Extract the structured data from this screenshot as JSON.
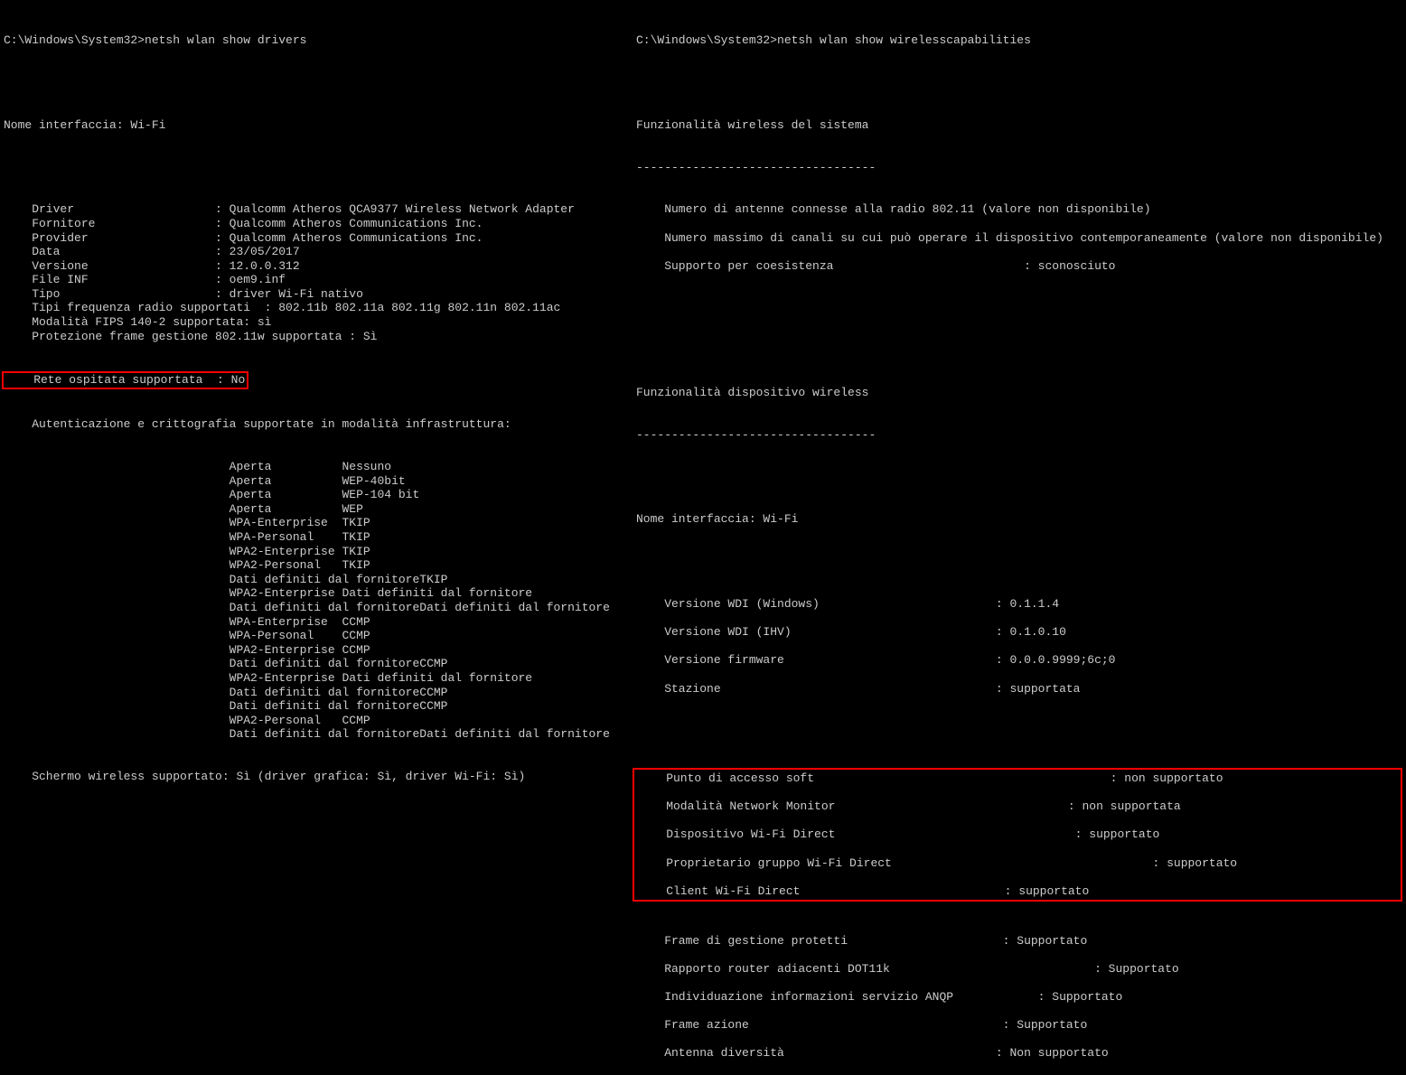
{
  "left": {
    "prompt": "C:\\Windows\\System32>netsh wlan show drivers",
    "iface": "Nome interfaccia: Wi-Fi",
    "rows": [
      "    Driver                    : Qualcomm Atheros QCA9377 Wireless Network Adapter",
      "    Fornitore                 : Qualcomm Atheros Communications Inc.",
      "    Provider                  : Qualcomm Atheros Communications Inc.",
      "    Data                      : 23/05/2017",
      "    Versione                  : 12.0.0.312",
      "    File INF                  : oem9.inf",
      "    Tipo                      : driver Wi-Fi nativo",
      "    Tipi frequenza radio supportati  : 802.11b 802.11a 802.11g 802.11n 802.11ac",
      "    Modalità FIPS 140-2 supportata: sì",
      "    Protezione frame gestione 802.11w supportata : Sì"
    ],
    "hosted": "    Rete ospitata supportata  : No",
    "auth_title": "    Autenticazione e crittografia supportate in modalità infrastruttura:",
    "auth_rows": [
      "                                Aperta          Nessuno",
      "                                Aperta          WEP-40bit",
      "                                Aperta          WEP-104 bit",
      "                                Aperta          WEP",
      "                                WPA-Enterprise  TKIP",
      "                                WPA-Personal    TKIP",
      "                                WPA2-Enterprise TKIP",
      "                                WPA2-Personal   TKIP",
      "                                Dati definiti dal fornitoreTKIP",
      "                                WPA2-Enterprise Dati definiti dal fornitore",
      "                                Dati definiti dal fornitoreDati definiti dal fornitore",
      "                                WPA-Enterprise  CCMP",
      "                                WPA-Personal    CCMP",
      "                                WPA2-Enterprise CCMP",
      "                                Dati definiti dal fornitoreCCMP",
      "                                WPA2-Enterprise Dati definiti dal fornitore",
      "                                Dati definiti dal fornitoreCCMP",
      "                                Dati definiti dal fornitoreCCMP",
      "                                WPA2-Personal   CCMP",
      "                                Dati definiti dal fornitoreDati definiti dal fornitore"
    ],
    "wireless_display": "    Schermo wireless supportato: Sì (driver grafica: Sì, driver Wi-Fi: Sì)"
  },
  "right": {
    "prompt": "C:\\Windows\\System32>netsh wlan show wirelesscapabilities",
    "sys_title": "Funzionalità wireless del sistema",
    "dashes1": "----------------------------------",
    "sys_rows": [
      "    Numero di antenne connesse alla radio 802.11 (valore non disponibile)",
      "",
      "    Numero massimo di canali su cui può operare il dispositivo contemporaneamente (valore non disponibile)",
      "",
      "    Supporto per coesistenza                           : sconosciuto"
    ],
    "dev_title": "Funzionalità dispositivo wireless",
    "dashes2": "----------------------------------",
    "iface": "Nome interfaccia: Wi-Fi",
    "dev_rows1": [
      "    Versione WDI (Windows)                         : 0.1.1.4",
      "",
      "    Versione WDI (IHV)                             : 0.1.0.10",
      "",
      "    Versione firmware                              : 0.0.0.9999;6c;0",
      "",
      "    Stazione                                       : supportata"
    ],
    "highlight_rows": [
      "    Punto di accesso soft                                          : non supportato",
      "",
      "    Modalità Network Monitor                                 : non supportata",
      "",
      "    Dispositivo Wi-Fi Direct                                  : supportato",
      "",
      "    Proprietario gruppo Wi-Fi Direct                                     : supportato",
      "",
      "    Client Wi-Fi Direct                             : supportato"
    ],
    "dev_rows2": [
      "    Frame di gestione protetti                      : Supportato",
      "",
      "    Rapporto router adiacenti DOT11k                             : Supportato",
      "",
      "    Individuazione informazioni servizio ANQP            : Supportato",
      "",
      "    Frame azione                                    : Supportato",
      "",
      "    Antenna diversità                              : Non supportato"
    ]
  }
}
